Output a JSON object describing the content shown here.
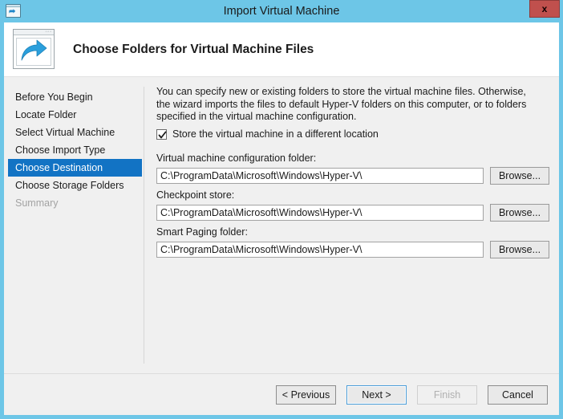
{
  "window": {
    "title": "Import Virtual Machine",
    "icon": "import-vm-window-icon",
    "close_label": "x"
  },
  "header": {
    "title": "Choose Folders for Virtual Machine Files",
    "icon": "import-arrow-icon"
  },
  "sidebar": {
    "items": [
      {
        "label": "Before You Begin",
        "state": "normal"
      },
      {
        "label": "Locate Folder",
        "state": "normal"
      },
      {
        "label": "Select Virtual Machine",
        "state": "normal"
      },
      {
        "label": "Choose Import Type",
        "state": "normal"
      },
      {
        "label": "Choose Destination",
        "state": "selected"
      },
      {
        "label": "Choose Storage Folders",
        "state": "normal"
      },
      {
        "label": "Summary",
        "state": "disabled"
      }
    ]
  },
  "main": {
    "description": "You can specify new or existing folders to store the virtual machine files. Otherwise, the wizard imports the files to default Hyper-V folders on this computer, or to folders specified in the virtual machine configuration.",
    "checkbox": {
      "label": "Store the virtual machine in a different location",
      "checked": true
    },
    "fields": [
      {
        "label": "Virtual machine configuration folder:",
        "value": "C:\\ProgramData\\Microsoft\\Windows\\Hyper-V\\",
        "browse_label": "Browse..."
      },
      {
        "label": "Checkpoint store:",
        "value": "C:\\ProgramData\\Microsoft\\Windows\\Hyper-V\\",
        "browse_label": "Browse..."
      },
      {
        "label": "Smart Paging folder:",
        "value": "C:\\ProgramData\\Microsoft\\Windows\\Hyper-V\\",
        "browse_label": "Browse..."
      }
    ]
  },
  "footer": {
    "previous_label": "< Previous",
    "next_label": "Next >",
    "finish_label": "Finish",
    "cancel_label": "Cancel"
  },
  "colors": {
    "titlebar": "#6dc6e7",
    "selection": "#1273c4",
    "close_button": "#c0504d",
    "body": "#f0f0f0",
    "accent_arrow": "#1e86c8"
  }
}
